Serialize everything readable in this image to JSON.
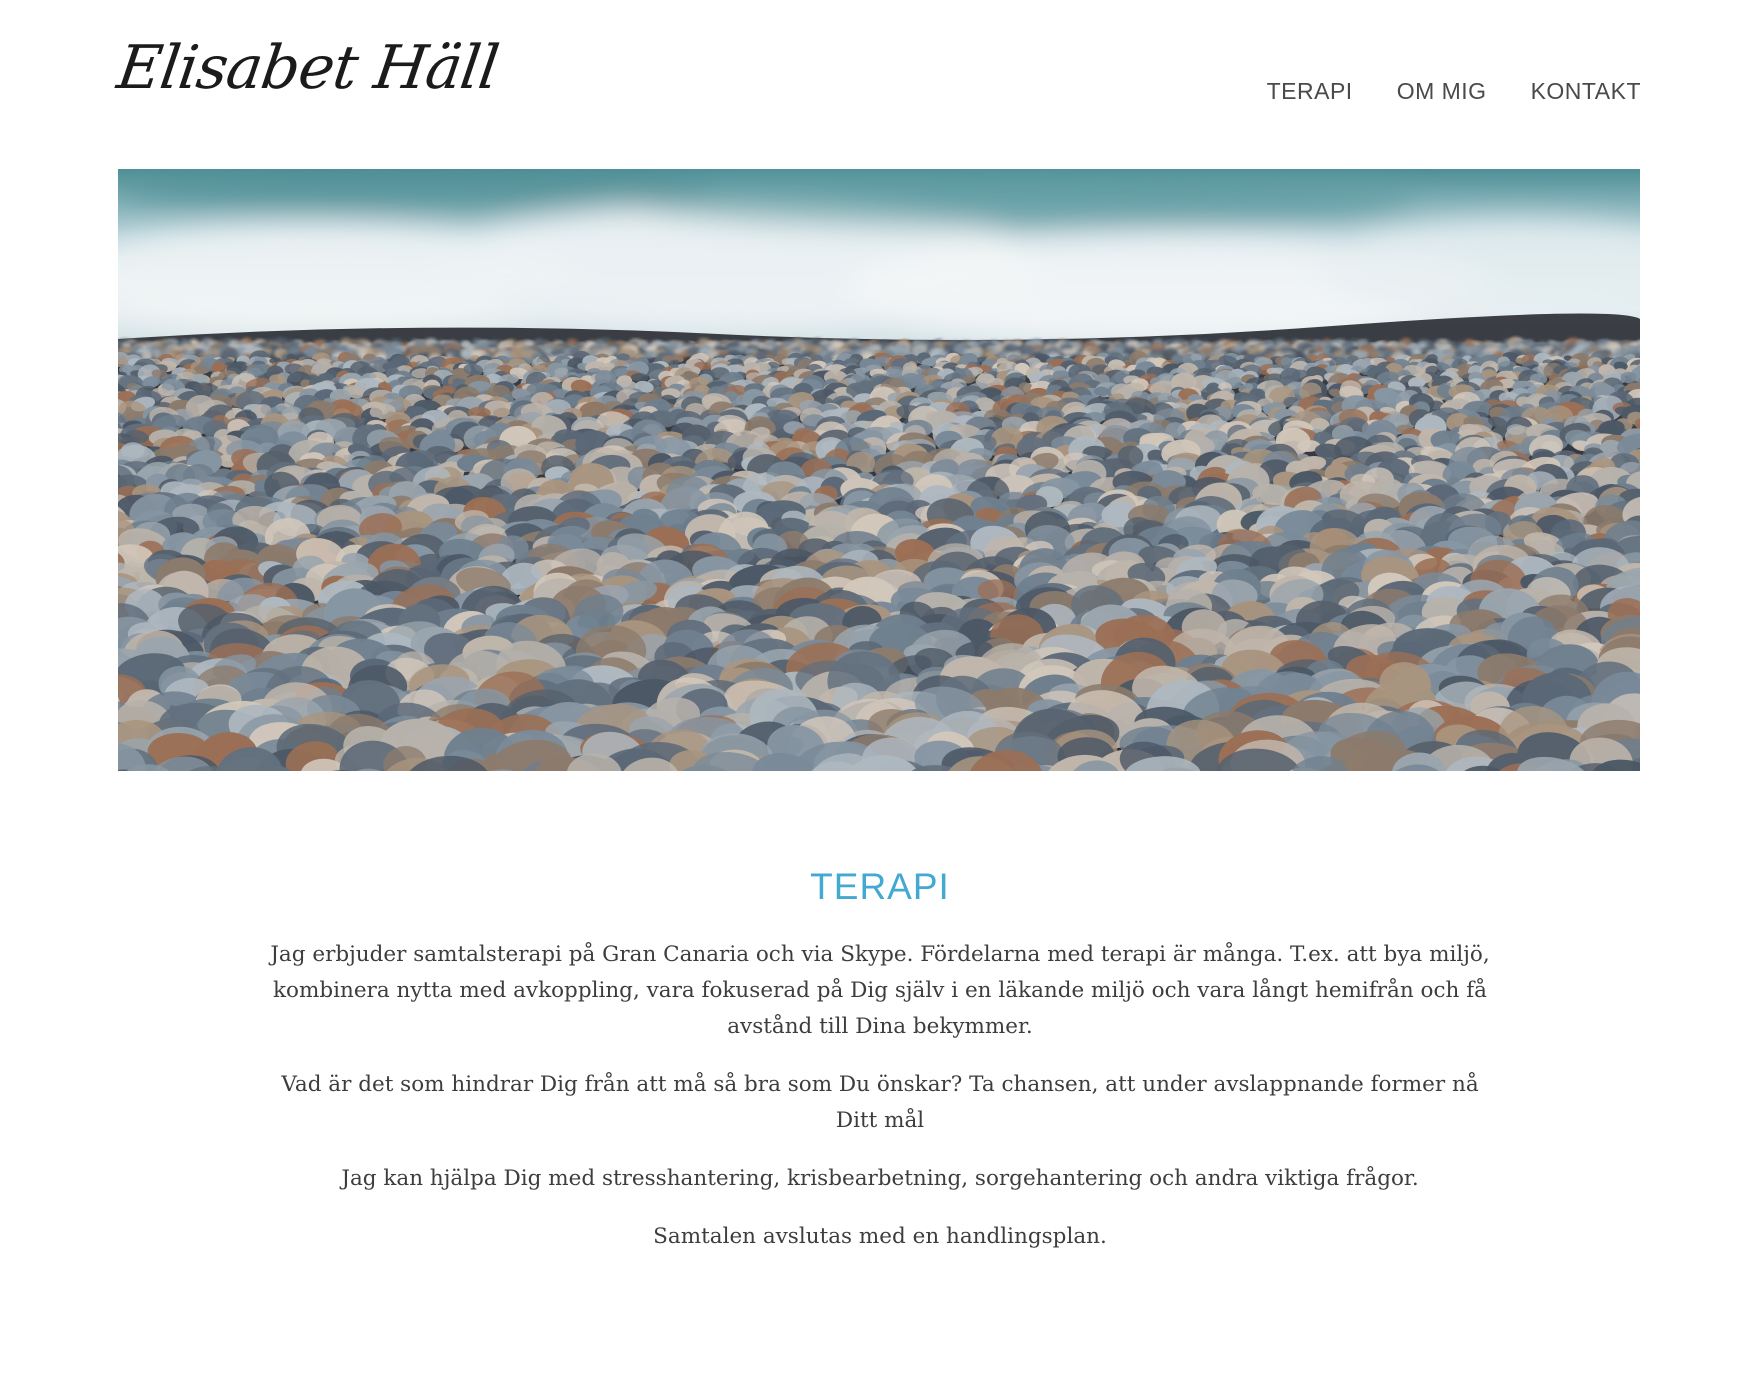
{
  "header": {
    "logo_text": "Elisabet Häll",
    "nav": [
      {
        "label": "TERAPI"
      },
      {
        "label": "OM MIG"
      },
      {
        "label": "KONTAKT"
      }
    ]
  },
  "hero": {
    "image_description_icon": "pebble-beach-photo"
  },
  "main": {
    "title": "TERAPI",
    "paragraphs": [
      "Jag erbjuder samtalsterapi på Gran Canaria och via Skype. Fördelarna med terapi är många. T.ex. att bya miljö, kombinera nytta med avkoppling, vara fokuserad på Dig själv i en läkande miljö och vara långt hemifrån och få avstånd till Dina bekymmer.",
      "Vad är det som hindrar Dig från att må så bra som Du önskar? Ta chansen, att under avslappnande former nå Ditt mål",
      "Jag kan hjälpa Dig med stresshantering, krisbearbetning, sorgehantering och andra viktiga frågor.",
      "Samtalen avslutas med en handlingsplan."
    ]
  },
  "colors": {
    "accent": "#43a9d1",
    "text": "#3d3d3d",
    "logo": "#1b1b1b"
  }
}
